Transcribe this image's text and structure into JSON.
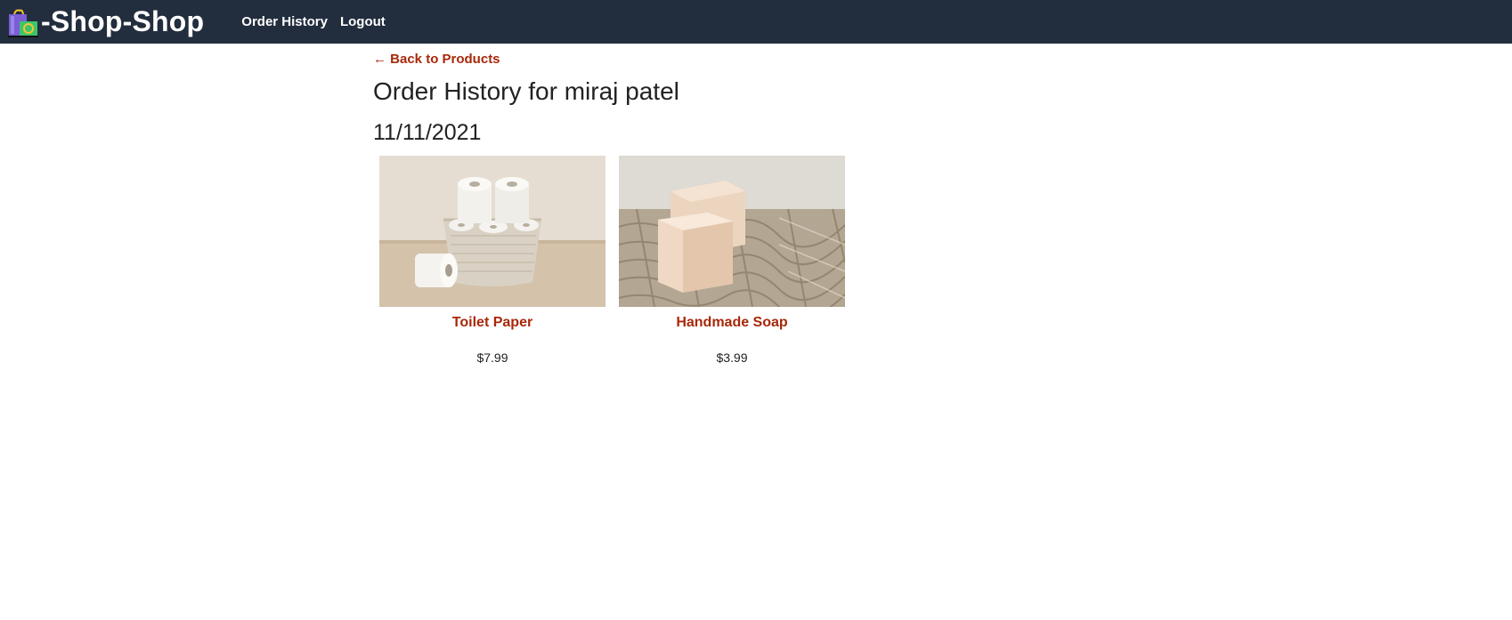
{
  "header": {
    "brand_title": "-Shop-Shop",
    "logo_icon": "shopping-bags-icon",
    "nav": [
      {
        "label": "Order History"
      },
      {
        "label": "Logout"
      }
    ]
  },
  "main": {
    "back_link": "← Back to Products",
    "title": "Order History for miraj patel",
    "orders": [
      {
        "date": "11/11/2021",
        "items": [
          {
            "name": "Toilet Paper",
            "price": "$7.99",
            "image": "toilet-paper-photo"
          },
          {
            "name": "Handmade Soap",
            "price": "$3.99",
            "image": "handmade-soap-photo"
          }
        ]
      }
    ]
  },
  "colors": {
    "navbar": "#222d3d",
    "accent": "#a8280a",
    "text": "#222222"
  }
}
